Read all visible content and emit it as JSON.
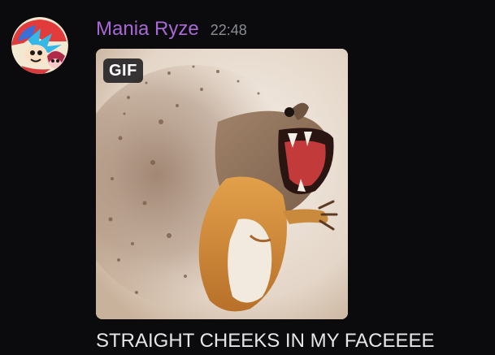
{
  "message": {
    "author": "Mania Ryze",
    "timestamp": "22:48",
    "text": "STRAIGHT CHEEKS IN MY FACEEEE",
    "author_color": "#a868d6"
  },
  "attachment": {
    "badge": "GIF",
    "icon": "gif-squirrel-image"
  },
  "avatar": {
    "icon": "avatar-cartoon-icon"
  }
}
